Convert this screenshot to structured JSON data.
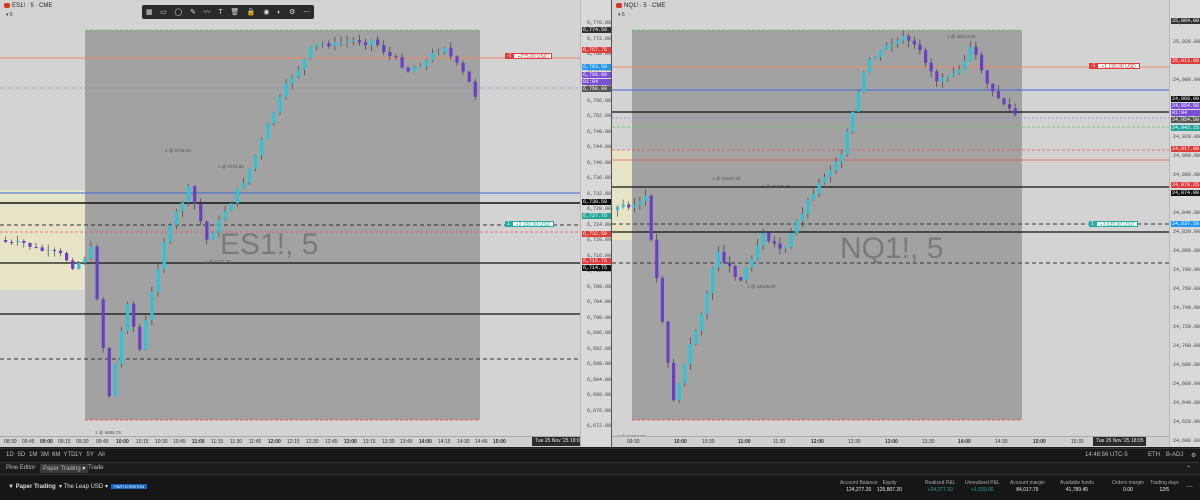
{
  "toolbar_icons": [
    "grid-icon",
    "rectangle-icon",
    "ellipse-icon",
    "pencil-icon",
    "brush-icon",
    "text-icon",
    "trash-icon",
    "lock-icon",
    "camera-icon",
    "eye-icon",
    "settings-icon",
    "more-icon"
  ],
  "left": {
    "header": "ES1! · 5 · CME",
    "interval_sub": "5",
    "watermark": "ES1!, 5",
    "order_tags": [
      {
        "qty": "-1",
        "text": "+275.00 USD"
      },
      {
        "qty": "1",
        "text": "+2,150.00 USD"
      }
    ],
    "marker_labels": [
      "1 @ 6739.25",
      "1 @ 6731.50",
      "1 @ 6722.75",
      "1 @ 6688.75"
    ],
    "price_labels": [
      "6,776.00",
      "6,772.00",
      "6,768.00",
      "6,764.00",
      "6,760.00",
      "6,756.00",
      "6,752.00",
      "6,748.00",
      "6,744.00",
      "6,740.00",
      "6,736.00",
      "6,732.00",
      "6,728.00",
      "6,724.00",
      "6,720.00",
      "6,716.00",
      "6,712.00",
      "6,708.00",
      "6,704.00",
      "6,700.00",
      "6,696.00",
      "6,692.00",
      "6,688.00",
      "6,684.00",
      "6,680.00",
      "6,676.00",
      "6,672.00"
    ],
    "price_tags": [
      {
        "text": "6,774.50",
        "color": "#333333"
      },
      {
        "text": "6,767.75",
        "color": "#e03c3c"
      },
      {
        "text": "6,763.50",
        "color": "#2196f3"
      },
      {
        "text": "6,760.00",
        "color": "#7a4fd6"
      },
      {
        "text": "01:04",
        "color": "#7a4fd6"
      },
      {
        "text": "6,760.00",
        "color": "#555555"
      },
      {
        "text": "6,730.50",
        "color": "#111111"
      },
      {
        "text": "6,727.75",
        "color": "#26a69a"
      },
      {
        "text": "6,722.50",
        "color": "#e03c3c"
      },
      {
        "text": "6,715.75",
        "color": "#e03c3c"
      },
      {
        "text": "6,714.75",
        "color": "#111111"
      }
    ],
    "time_labels": [
      "08:30",
      "09:45",
      "09:00",
      "09:15",
      "09:30",
      "09:45",
      "10:00",
      "10:15",
      "10:30",
      "10:45",
      "11:00",
      "11:15",
      "11:30",
      "11:45",
      "12:00",
      "12:15",
      "12:30",
      "12:45",
      "13:00",
      "13:15",
      "13:30",
      "13:45",
      "14:00",
      "14:15",
      "14:30",
      "14:45",
      "15:00"
    ],
    "date_badge": "Tue 25 Nov '25   18:05"
  },
  "right": {
    "header": "NQ1! · 5 · CME",
    "interval_sub": "5",
    "watermark": "NQ1!, 5",
    "order_tags": [
      {
        "qty": "-1",
        "text": "+1,155.00 USD"
      },
      {
        "qty": "1",
        "text": "+3,635.00 USD"
      }
    ],
    "marker_labels": [
      "1 @ 25013.00",
      "1 @ 24837.50",
      "1 @ 24775.25",
      "1 @ 24636.00",
      "1 @ 24657.75"
    ],
    "price_labels": [
      "25,040.00",
      "25,020.00",
      "25,000.00",
      "24,980.00",
      "24,960.00",
      "24,940.00",
      "24,920.00",
      "24,900.00",
      "24,880.00",
      "24,860.00",
      "24,840.00",
      "24,820.00",
      "24,800.00",
      "24,780.00",
      "24,760.00",
      "24,740.00",
      "24,720.00",
      "24,700.00",
      "24,680.00",
      "24,660.00",
      "24,640.00",
      "24,620.00",
      "24,600.00"
    ],
    "price_tags": [
      {
        "text": "25,064.00",
        "color": "#333333"
      },
      {
        "text": "25,013.00",
        "color": "#e03c3c"
      },
      {
        "text": "24,960.00",
        "color": "#111111"
      },
      {
        "text": "24,954.50",
        "color": "#7a4fd6"
      },
      {
        "text": "01:04",
        "color": "#7a4fd6"
      },
      {
        "text": "24,954.50",
        "color": "#555555"
      },
      {
        "text": "24,942.25",
        "color": "#26a69a"
      },
      {
        "text": "24,917.00",
        "color": "#e03c3c"
      },
      {
        "text": "24,878.25",
        "color": "#e03c3c"
      },
      {
        "text": "24,874.00",
        "color": "#111111"
      },
      {
        "text": "24,837.50",
        "color": "#2196f3"
      }
    ],
    "time_labels": [
      "09:30",
      "10:00",
      "10:30",
      "11:00",
      "11:30",
      "12:00",
      "12:30",
      "13:00",
      "13:30",
      "14:00",
      "14:30",
      "15:00",
      "15:30"
    ],
    "date_badge": "Tue 25 Nov '25   18:05"
  },
  "bottom_toolbar": {
    "ranges": [
      "1D",
      "5D",
      "1M",
      "3M",
      "6M",
      "YTD",
      "1Y",
      "5Y",
      "All"
    ],
    "clock": "14:48:56 UTC-5",
    "session": "ETH",
    "adj": "B-ADJ"
  },
  "tabs": [
    "Pine Editor",
    "Paper Trading",
    "Trade"
  ],
  "broker": {
    "name": "Paper Trading",
    "account": "The Leap USD",
    "badge": "PARTICIPATION"
  },
  "account_stats": [
    {
      "label": "Account Balance",
      "value": "124,277.20",
      "positive": false
    },
    {
      "label": "Equity",
      "value": "125,807.20",
      "positive": false
    },
    {
      "label": "Realized P&L",
      "value": "+24,277.20",
      "positive": true
    },
    {
      "label": "Unrealized P&L",
      "value": "+1,530.00",
      "positive": true
    },
    {
      "label": "Account margin",
      "value": "84,017.75",
      "positive": false
    },
    {
      "label": "Available funds",
      "value": "41,789.45",
      "positive": false
    },
    {
      "label": "Orders margin",
      "value": "0.00",
      "positive": false
    },
    {
      "label": "Trading days",
      "value": "12/5",
      "positive": false
    }
  ]
}
